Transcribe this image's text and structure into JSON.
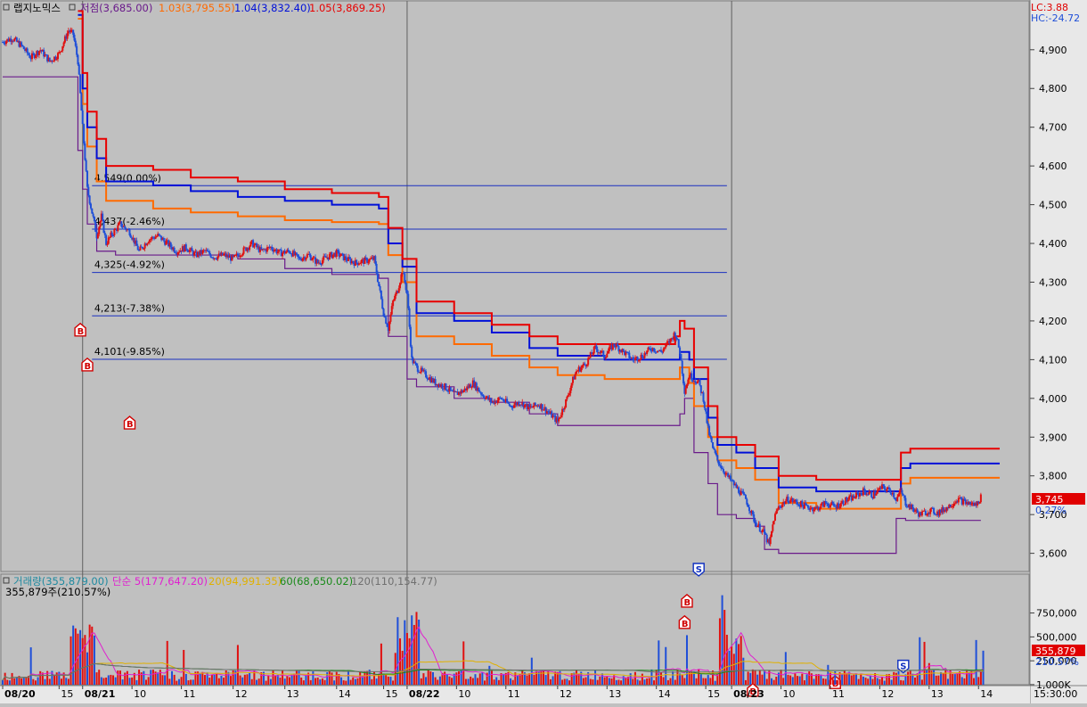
{
  "colors": {
    "price_up": "#e01010",
    "price_down": "#1f4fd8",
    "ref_lines": "#1a2fc0",
    "stop_red": "#e80000",
    "stop_blue": "#0010d8",
    "stop_orange": "#ff6a00",
    "stop_low": "#6a1a8a",
    "ma5": "#e020d0",
    "ma20": "#e0b000",
    "ma60": "#1a8a1a",
    "ma120": "#707070",
    "badge_price_bg": "#e00000"
  },
  "header": {
    "name": "랩지노믹스",
    "low_label": "저점(3,685.00)",
    "lvl103": "1.03(3,795.55)",
    "lvl104": "1.04(3,832.40)",
    "lvl105": "1.05(3,869.25)",
    "lc": "LC:3.88",
    "hc": "HC:-24.72"
  },
  "volume_header": {
    "vol": "거래량(355,879.00)",
    "ma5": "단순 5(177,647.20)",
    "ma20": "20(94,991.35)",
    "ma60": "60(68,650.02)",
    "ma120": "120(110,154.77)",
    "sub": "355,879주(210.57%)"
  },
  "chart_data": {
    "type": "line",
    "price_axis": {
      "ticks": [
        "4,900",
        "4,800",
        "4,700",
        "4,600",
        "4,500",
        "4,400",
        "4,300",
        "4,200",
        "4,100",
        "4,000",
        "3,900",
        "3,800",
        "3,700",
        "3,600"
      ],
      "ylim": [
        3560,
        5010
      ]
    },
    "volume_axis": {
      "ticks": [
        "1,000K",
        "750,000",
        "500,000",
        "250,000"
      ],
      "ylim": [
        0,
        1100000
      ]
    },
    "x_labels": [
      "08/20",
      "15",
      "08/21",
      "10",
      "11",
      "12",
      "13",
      "14",
      "15",
      "08/22",
      "10",
      "11",
      "12",
      "13",
      "14",
      "15",
      "08/23",
      "10",
      "11",
      "12",
      "13",
      "14",
      "15"
    ],
    "time_label": "15:30:00",
    "current_price": "3,745",
    "current_change": "0.27%",
    "current_volume": "355,879",
    "current_volume_pct": "210.57%",
    "ref_levels": [
      {
        "label": "4,549(0.00%)",
        "value": 4549
      },
      {
        "label": "4,437(-2.46%)",
        "value": 4437
      },
      {
        "label": "4,325(-4.92%)",
        "value": 4325
      },
      {
        "label": "4,213(-7.38%)",
        "value": 4213
      },
      {
        "label": "4,101(-9.85%)",
        "value": 4101
      }
    ],
    "signals": [
      {
        "type": "B",
        "t": 16.5,
        "price": 4175
      },
      {
        "type": "B",
        "t": 18.0,
        "price": 4085
      },
      {
        "type": "B",
        "t": 27.0,
        "price": 3935
      },
      {
        "type": "S",
        "t": 148.0,
        "price": 3560
      },
      {
        "type": "B",
        "t": 145.5,
        "price": 3475
      },
      {
        "type": "B",
        "t": 145.0,
        "price": 3420
      },
      {
        "type": "B",
        "t": 159.5,
        "price": 3245
      },
      {
        "type": "B",
        "t": 177.0,
        "price": 3265
      },
      {
        "type": "S",
        "t": 191.5,
        "price": 3310
      }
    ],
    "price_path": [
      [
        0,
        4920
      ],
      [
        2,
        4930
      ],
      [
        4,
        4910
      ],
      [
        6,
        4880
      ],
      [
        8,
        4900
      ],
      [
        10,
        4870
      ],
      [
        12,
        4890
      ],
      [
        14,
        4950
      ],
      [
        15,
        4940
      ],
      [
        16,
        4870
      ],
      [
        17,
        4700
      ],
      [
        18,
        4540
      ],
      [
        19,
        4480
      ],
      [
        20,
        4420
      ],
      [
        21,
        4470
      ],
      [
        22,
        4400
      ],
      [
        23,
        4420
      ],
      [
        25,
        4450
      ],
      [
        27,
        4430
      ],
      [
        29,
        4380
      ],
      [
        31,
        4410
      ],
      [
        33,
        4420
      ],
      [
        35,
        4400
      ],
      [
        37,
        4380
      ],
      [
        39,
        4390
      ],
      [
        41,
        4370
      ],
      [
        43,
        4380
      ],
      [
        45,
        4365
      ],
      [
        47,
        4370
      ],
      [
        49,
        4360
      ],
      [
        51,
        4380
      ],
      [
        53,
        4400
      ],
      [
        55,
        4380
      ],
      [
        57,
        4390
      ],
      [
        59,
        4375
      ],
      [
        61,
        4380
      ],
      [
        63,
        4360
      ],
      [
        65,
        4370
      ],
      [
        67,
        4350
      ],
      [
        69,
        4365
      ],
      [
        71,
        4375
      ],
      [
        73,
        4360
      ],
      [
        75,
        4350
      ],
      [
        77,
        4355
      ],
      [
        79,
        4360
      ],
      [
        81,
        4220
      ],
      [
        82,
        4180
      ],
      [
        83,
        4250
      ],
      [
        84,
        4280
      ],
      [
        85,
        4330
      ],
      [
        86,
        4270
      ],
      [
        87,
        4100
      ],
      [
        88,
        4080
      ],
      [
        90,
        4060
      ],
      [
        92,
        4040
      ],
      [
        94,
        4030
      ],
      [
        96,
        4010
      ],
      [
        98,
        4020
      ],
      [
        100,
        4040
      ],
      [
        102,
        4010
      ],
      [
        104,
        3990
      ],
      [
        106,
        4000
      ],
      [
        108,
        3980
      ],
      [
        110,
        3990
      ],
      [
        112,
        3975
      ],
      [
        114,
        3985
      ],
      [
        116,
        3965
      ],
      [
        118,
        3940
      ],
      [
        120,
        4000
      ],
      [
        121,
        4040
      ],
      [
        122,
        4070
      ],
      [
        124,
        4090
      ],
      [
        126,
        4130
      ],
      [
        128,
        4110
      ],
      [
        130,
        4140
      ],
      [
        132,
        4120
      ],
      [
        134,
        4100
      ],
      [
        136,
        4110
      ],
      [
        138,
        4130
      ],
      [
        140,
        4120
      ],
      [
        142,
        4150
      ],
      [
        143,
        4170
      ],
      [
        144,
        4120
      ],
      [
        145,
        4020
      ],
      [
        146,
        4060
      ],
      [
        148,
        4040
      ],
      [
        149,
        4000
      ],
      [
        150,
        3920
      ],
      [
        151,
        3870
      ],
      [
        152,
        3840
      ],
      [
        154,
        3800
      ],
      [
        156,
        3770
      ],
      [
        158,
        3740
      ],
      [
        160,
        3680
      ],
      [
        162,
        3650
      ],
      [
        163,
        3620
      ],
      [
        164,
        3690
      ],
      [
        165,
        3720
      ],
      [
        167,
        3740
      ],
      [
        169,
        3730
      ],
      [
        171,
        3720
      ],
      [
        173,
        3715
      ],
      [
        175,
        3730
      ],
      [
        177,
        3720
      ],
      [
        179,
        3735
      ],
      [
        181,
        3745
      ],
      [
        183,
        3760
      ],
      [
        185,
        3750
      ],
      [
        187,
        3770
      ],
      [
        189,
        3760
      ],
      [
        190,
        3740
      ],
      [
        191,
        3760
      ],
      [
        192,
        3730
      ],
      [
        193,
        3720
      ],
      [
        195,
        3700
      ],
      [
        197,
        3710
      ],
      [
        199,
        3705
      ],
      [
        201,
        3720
      ],
      [
        203,
        3740
      ],
      [
        205,
        3730
      ],
      [
        207,
        3725
      ],
      [
        208,
        3745
      ]
    ],
    "stop_red": [
      [
        16,
        5000
      ],
      [
        17,
        4840
      ],
      [
        18,
        4740
      ],
      [
        20,
        4670
      ],
      [
        22,
        4600
      ],
      [
        32,
        4590
      ],
      [
        40,
        4570
      ],
      [
        50,
        4560
      ],
      [
        60,
        4540
      ],
      [
        70,
        4530
      ],
      [
        80,
        4520
      ],
      [
        82,
        4440
      ],
      [
        85,
        4360
      ],
      [
        88,
        4250
      ],
      [
        96,
        4220
      ],
      [
        104,
        4190
      ],
      [
        112,
        4160
      ],
      [
        118,
        4140
      ],
      [
        128,
        4140
      ],
      [
        140,
        4140
      ],
      [
        143,
        4160
      ],
      [
        144,
        4200
      ],
      [
        145,
        4180
      ],
      [
        147,
        4080
      ],
      [
        150,
        3980
      ],
      [
        152,
        3900
      ],
      [
        156,
        3880
      ],
      [
        160,
        3850
      ],
      [
        165,
        3800
      ],
      [
        173,
        3790
      ],
      [
        190,
        3790
      ],
      [
        191,
        3860
      ],
      [
        193,
        3870
      ],
      [
        212,
        3870
      ]
    ],
    "stop_blue": [
      [
        16,
        4990
      ],
      [
        17,
        4800
      ],
      [
        18,
        4700
      ],
      [
        20,
        4620
      ],
      [
        22,
        4560
      ],
      [
        32,
        4550
      ],
      [
        40,
        4535
      ],
      [
        50,
        4520
      ],
      [
        60,
        4510
      ],
      [
        70,
        4500
      ],
      [
        80,
        4490
      ],
      [
        82,
        4400
      ],
      [
        85,
        4340
      ],
      [
        88,
        4220
      ],
      [
        96,
        4200
      ],
      [
        104,
        4170
      ],
      [
        112,
        4130
      ],
      [
        118,
        4110
      ],
      [
        128,
        4100
      ],
      [
        140,
        4100
      ],
      [
        144,
        4120
      ],
      [
        146,
        4100
      ],
      [
        147,
        4050
      ],
      [
        150,
        3950
      ],
      [
        152,
        3880
      ],
      [
        156,
        3860
      ],
      [
        160,
        3820
      ],
      [
        165,
        3770
      ],
      [
        173,
        3760
      ],
      [
        190,
        3760
      ],
      [
        191,
        3820
      ],
      [
        193,
        3832
      ],
      [
        212,
        3832
      ]
    ],
    "stop_orange": [
      [
        16,
        4980
      ],
      [
        17,
        4760
      ],
      [
        18,
        4650
      ],
      [
        20,
        4560
      ],
      [
        22,
        4510
      ],
      [
        32,
        4490
      ],
      [
        40,
        4480
      ],
      [
        50,
        4470
      ],
      [
        60,
        4460
      ],
      [
        70,
        4455
      ],
      [
        80,
        4450
      ],
      [
        82,
        4370
      ],
      [
        85,
        4300
      ],
      [
        88,
        4160
      ],
      [
        96,
        4140
      ],
      [
        104,
        4110
      ],
      [
        112,
        4080
      ],
      [
        118,
        4060
      ],
      [
        128,
        4050
      ],
      [
        140,
        4050
      ],
      [
        144,
        4080
      ],
      [
        146,
        4040
      ],
      [
        147,
        3980
      ],
      [
        150,
        3900
      ],
      [
        152,
        3840
      ],
      [
        156,
        3820
      ],
      [
        160,
        3790
      ],
      [
        165,
        3730
      ],
      [
        173,
        3715
      ],
      [
        190,
        3715
      ],
      [
        191,
        3780
      ],
      [
        193,
        3795
      ],
      [
        212,
        3795
      ]
    ],
    "stop_low": [
      [
        0,
        4830
      ],
      [
        15,
        4830
      ],
      [
        16,
        4640
      ],
      [
        17,
        4540
      ],
      [
        18,
        4450
      ],
      [
        20,
        4380
      ],
      [
        24,
        4370
      ],
      [
        32,
        4370
      ],
      [
        50,
        4360
      ],
      [
        60,
        4335
      ],
      [
        70,
        4320
      ],
      [
        80,
        4310
      ],
      [
        82,
        4160
      ],
      [
        86,
        4050
      ],
      [
        88,
        4030
      ],
      [
        96,
        4000
      ],
      [
        104,
        3990
      ],
      [
        112,
        3960
      ],
      [
        118,
        3930
      ],
      [
        132,
        3930
      ],
      [
        140,
        3930
      ],
      [
        143,
        3930
      ],
      [
        144,
        3960
      ],
      [
        145,
        4000
      ],
      [
        147,
        3860
      ],
      [
        150,
        3780
      ],
      [
        152,
        3700
      ],
      [
        156,
        3690
      ],
      [
        160,
        3670
      ],
      [
        162,
        3610
      ],
      [
        165,
        3600
      ],
      [
        188,
        3600
      ],
      [
        190,
        3690
      ],
      [
        192,
        3685
      ],
      [
        208,
        3685
      ]
    ]
  }
}
